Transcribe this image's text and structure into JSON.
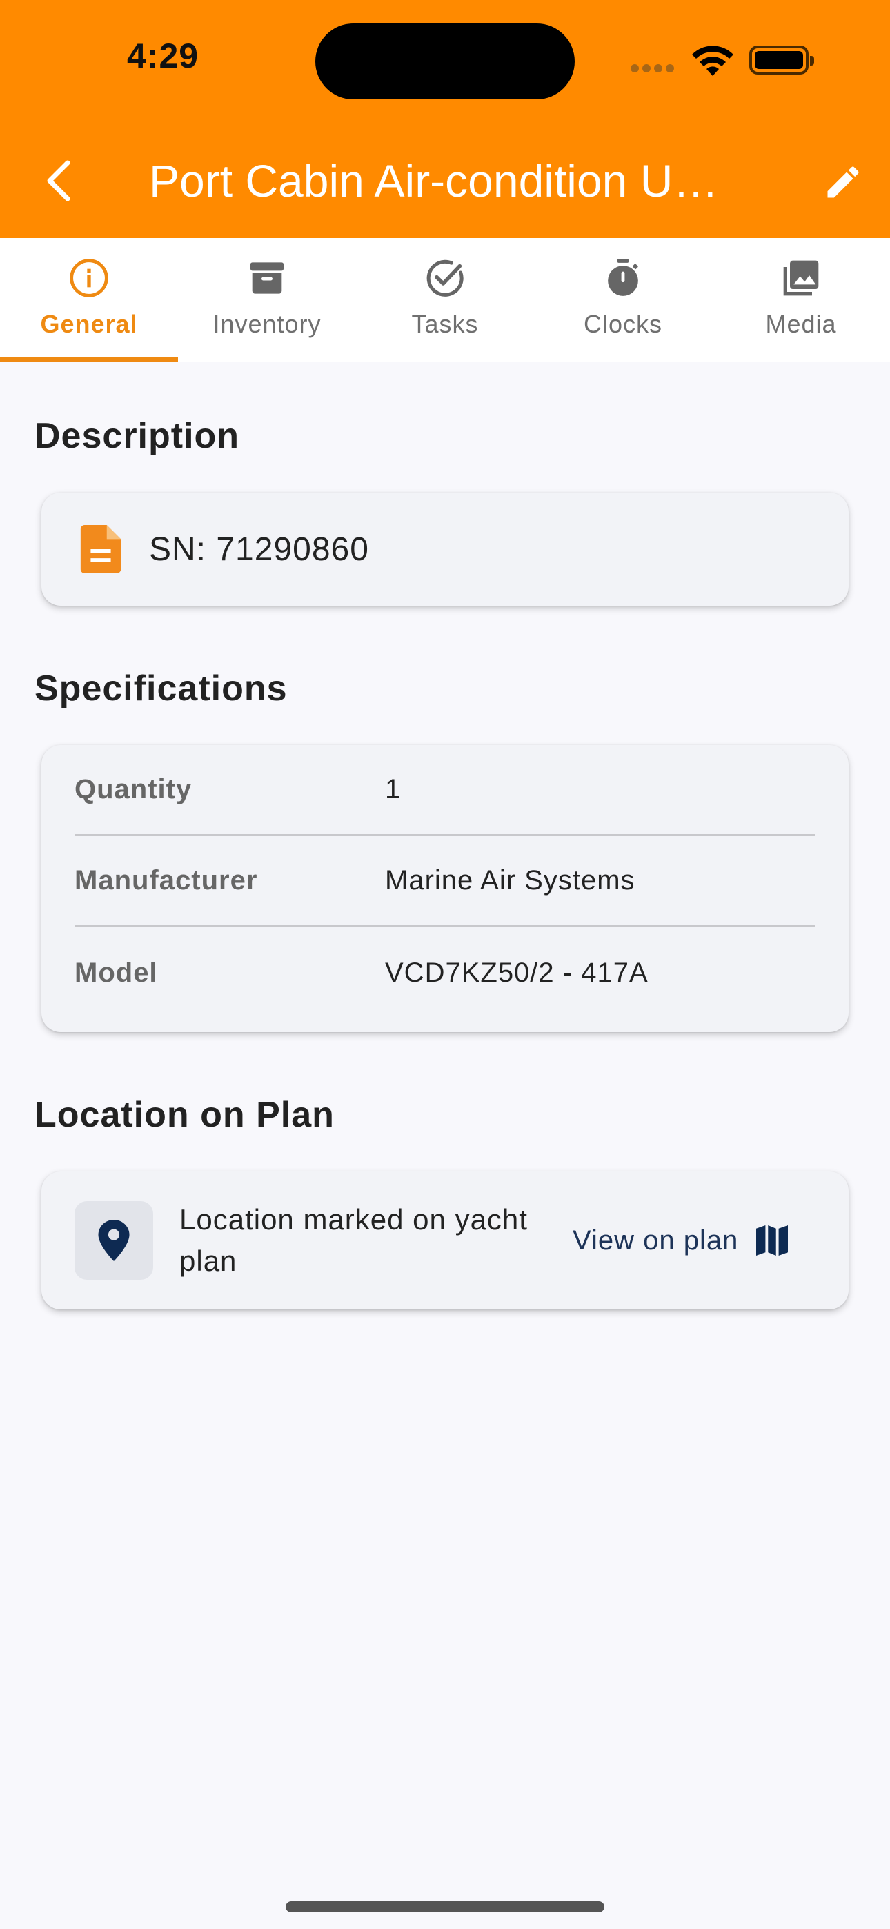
{
  "status_bar": {
    "time": "4:29"
  },
  "header": {
    "title": "Port Cabin Air-condition U…",
    "back_icon": "chevron-left-icon",
    "edit_icon": "pencil-icon",
    "background_color": "#ff8a00"
  },
  "tabs": [
    {
      "label": "General",
      "icon": "info-circle-icon",
      "active": true
    },
    {
      "label": "Inventory",
      "icon": "archive-box-icon",
      "active": false
    },
    {
      "label": "Tasks",
      "icon": "check-circle-icon",
      "active": false
    },
    {
      "label": "Clocks",
      "icon": "stopwatch-icon",
      "active": false
    },
    {
      "label": "Media",
      "icon": "image-gallery-icon",
      "active": false
    }
  ],
  "description": {
    "heading": "Description",
    "text": "SN: 71290860",
    "icon": "document-icon"
  },
  "specifications": {
    "heading": "Specifications",
    "rows": [
      {
        "label": "Quantity",
        "value": "1"
      },
      {
        "label": "Manufacturer",
        "value": "Marine Air Systems"
      },
      {
        "label": "Model",
        "value": "VCD7KZ50/2 - 417A"
      }
    ]
  },
  "location": {
    "heading": "Location on Plan",
    "text": "Location marked on yacht plan",
    "action_label": "View on plan",
    "pin_icon": "map-pin-icon",
    "map_icon": "map-icon"
  },
  "colors": {
    "accent": "#ef8a12",
    "navy": "#1d3358"
  }
}
